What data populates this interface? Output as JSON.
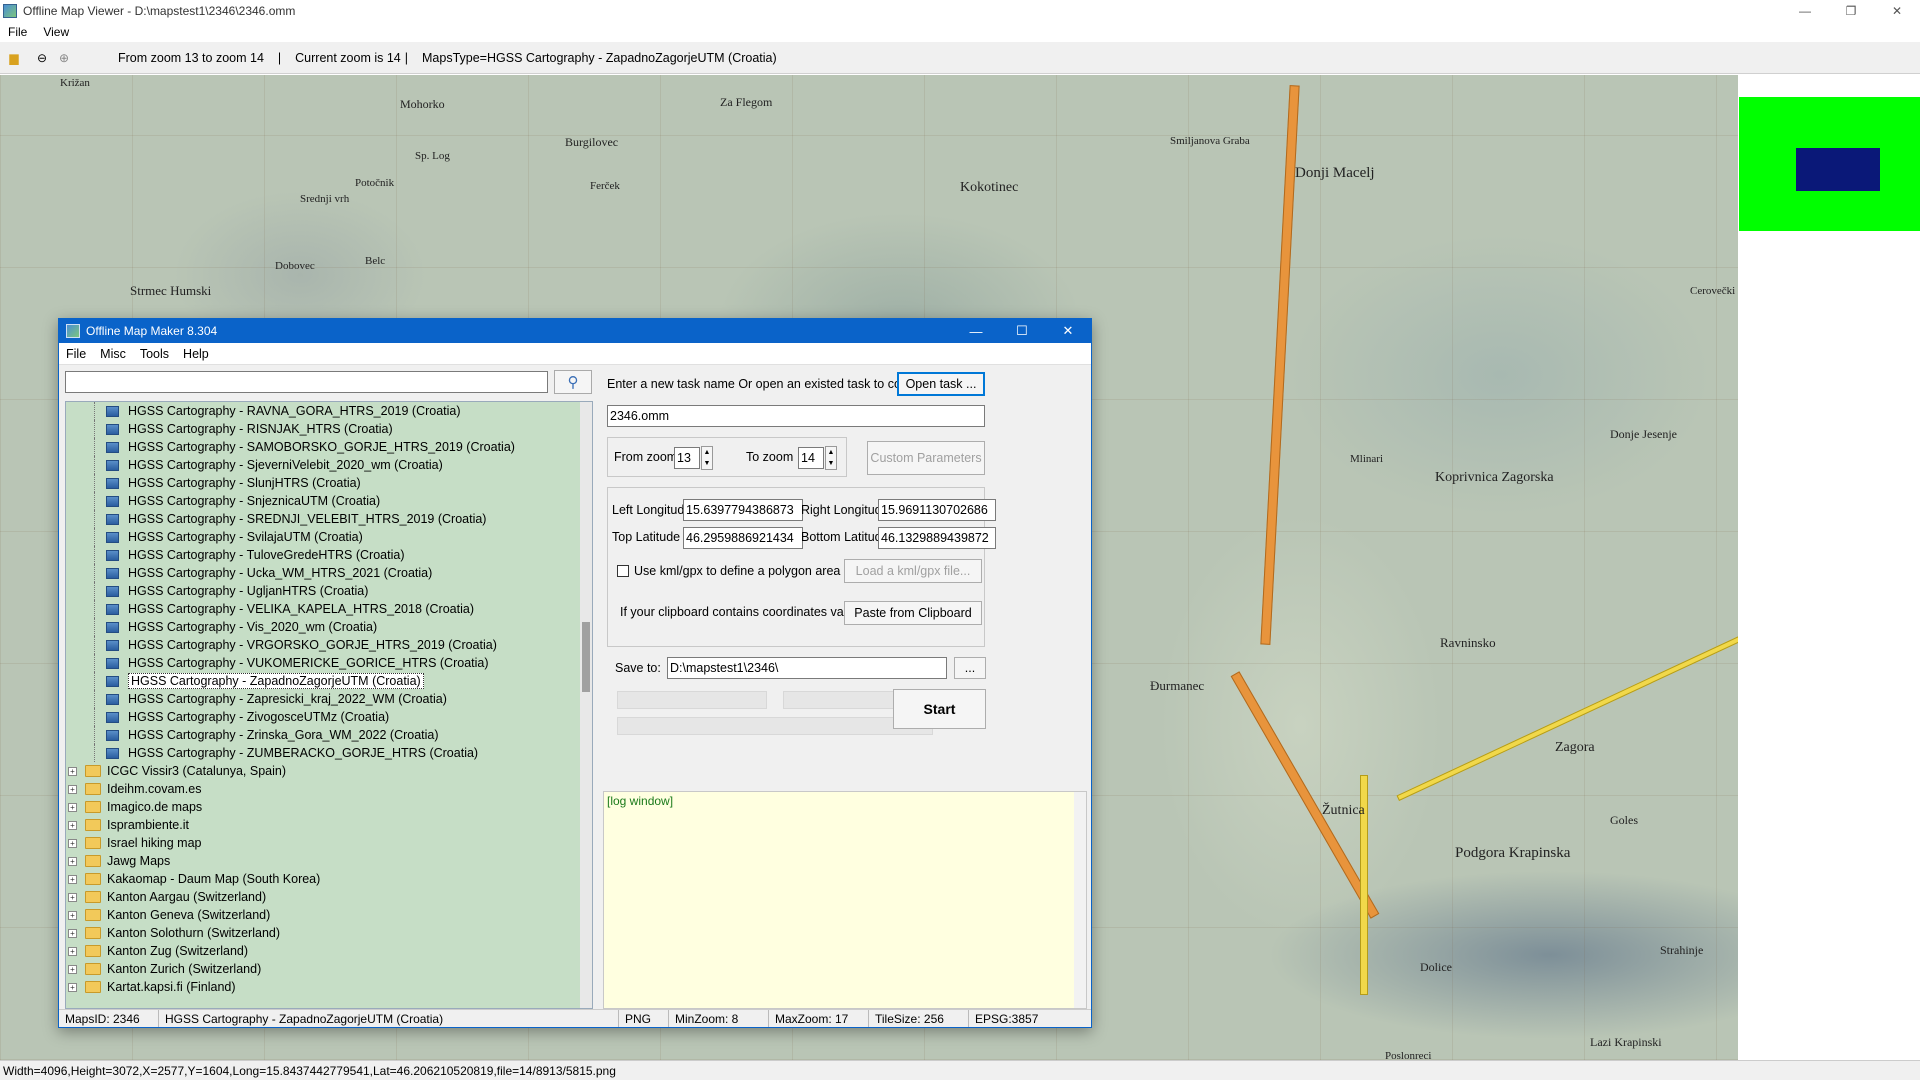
{
  "main_window": {
    "title": "Offline Map Viewer - D:\\mapstest1\\2346\\2346.omm",
    "menu": [
      "File",
      "View"
    ],
    "win_buttons": {
      "minimize": "—",
      "restore": "❐",
      "close": "✕"
    }
  },
  "toolbar": {
    "zoom_range": "From zoom 13 to zoom 14",
    "sep1": "|",
    "current_zoom": "Current zoom is 14",
    "sep2": "|",
    "maps_type": "MapsType=HGSS Cartography - ZapadnoZagorjeUTM (Croatia)"
  },
  "map_labels": [
    {
      "text": "Križan"
    },
    {
      "text": "Mohorko"
    },
    {
      "text": "Za Flegom"
    },
    {
      "text": "Burgilovec"
    },
    {
      "text": "Sp. Log"
    },
    {
      "text": "Potočnik"
    },
    {
      "text": "Ferček"
    },
    {
      "text": "Srednji vrh"
    },
    {
      "text": "Kokotinec"
    },
    {
      "text": "Smiljanova Graba"
    },
    {
      "text": "Donji Macelj"
    },
    {
      "text": "Strmec Humski"
    },
    {
      "text": "Dobovec"
    },
    {
      "text": "Belc"
    },
    {
      "text": "Koprivnica Zagorska"
    },
    {
      "text": "Donje Jesenje"
    },
    {
      "text": "Mlinari"
    },
    {
      "text": "Ravninsko"
    },
    {
      "text": "Đurmanec"
    },
    {
      "text": "Žutnica"
    },
    {
      "text": "Zagora"
    },
    {
      "text": "Podgora Krapinska"
    },
    {
      "text": "Strahinje"
    },
    {
      "text": "Dolice"
    },
    {
      "text": "Lazi Krapinski"
    },
    {
      "text": "Goles"
    },
    {
      "text": "Cerovečki"
    },
    {
      "text": "Poslonreci"
    }
  ],
  "status_text": "Width=4096,Height=3072,X=2577,Y=1604,Long=15.8437442779541,Lat=46.206210520819,file=14/8913/5815.png",
  "colors": {
    "overview_green": "#00ff00",
    "overview_blue": "#0a1878",
    "dialog_accent": "#0a63c9",
    "tree_bg": "#c6dec6",
    "log_bg": "#ffffe0"
  },
  "dialog": {
    "title": "Offline Map Maker 8.304",
    "menu": [
      "File",
      "Misc",
      "Tools",
      "Help"
    ],
    "search": {
      "value": "",
      "icon": "search-icon"
    },
    "tree_children": [
      "HGSS Cartography - RAVNA_GORA_HTRS_2019 (Croatia)",
      "HGSS Cartography - RISNJAK_HTRS (Croatia)",
      "HGSS Cartography - SAMOBORSKO_GORJE_HTRS_2019 (Croatia)",
      "HGSS Cartography - SjeverniVelebit_2020_wm (Croatia)",
      "HGSS Cartography - SlunjHTRS (Croatia)",
      "HGSS Cartography - SnjeznicaUTM (Croatia)",
      "HGSS Cartography - SREDNJI_VELEBIT_HTRS_2019 (Croatia)",
      "HGSS Cartography - SvilajaUTM (Croatia)",
      "HGSS Cartography - TuloveGredeHTRS (Croatia)",
      "HGSS Cartography - Ucka_WM_HTRS_2021 (Croatia)",
      "HGSS Cartography - UgljanHTRS (Croatia)",
      "HGSS Cartography - VELIKA_KAPELA_HTRS_2018 (Croatia)",
      "HGSS Cartography - Vis_2020_wm (Croatia)",
      "HGSS Cartography - VRGORSKO_GORJE_HTRS_2019 (Croatia)",
      "HGSS Cartography - VUKOMERICKE_GORICE_HTRS (Croatia)",
      "HGSS Cartography - ZapadnoZagorjeUTM (Croatia)",
      "HGSS Cartography - Zapresicki_kraj_2022_WM (Croatia)",
      "HGSS Cartography - ZivogosceUTMz (Croatia)",
      "HGSS Cartography - Zrinska_Gora_WM_2022 (Croatia)",
      "HGSS Cartography - ZUMBERACKO_GORJE_HTRS (Croatia)"
    ],
    "selected_index": 15,
    "tree_folders": [
      "ICGC Vissir3 (Catalunya, Spain)",
      "Ideihm.covam.es",
      "Imagico.de maps",
      "Isprambiente.it",
      "Israel hiking map",
      "Jawg Maps",
      "Kakaomap - Daum Map (South Korea)",
      "Kanton Aargau (Switzerland)",
      "Kanton Geneva (Switzerland)",
      "Kanton Solothurn (Switzerland)",
      "Kanton Zug (Switzerland)",
      "Kanton Zurich (Switzerland)",
      "Kartat.kapsi.fi (Finland)"
    ],
    "task_prompt": "Enter a new task name Or open an existed task to continue:",
    "open_task_label": "Open task ...",
    "task_name": "2346.omm",
    "from_zoom_label": "From zoom",
    "from_zoom": "13",
    "to_zoom_label": "To zoom",
    "to_zoom": "14",
    "custom_params_label": "Custom Parameters",
    "left_lon_label": "Left Longitude",
    "left_lon": "15.6397794386873",
    "right_lon_label": "Right Longitude",
    "right_lon": "15.9691130702686",
    "top_lat_label": "Top Latitude",
    "top_lat": "46.2959886921434",
    "bottom_lat_label": "Bottom Latitude",
    "bottom_lat": "46.1329889439872",
    "kml_label": "Use kml/gpx to define a polygon area",
    "load_kml_label": "Load a kml/gpx file...",
    "clipboard_prompt": "If your clipboard contains coordinates values:",
    "paste_label": "Paste from Clipboard",
    "save_to_label": "Save to:",
    "save_to": "D:\\mapstest1\\2346\\",
    "browse_label": "...",
    "start_label": "Start",
    "log_text": "[log window]",
    "status": {
      "maps_id": "MapsID: 2346",
      "map_name": "HGSS Cartography - ZapadnoZagorjeUTM (Croatia)",
      "format": "PNG",
      "min_zoom": "MinZoom: 8",
      "max_zoom": "MaxZoom: 17",
      "tile_size": "TileSize: 256",
      "epsg": "EPSG:3857"
    }
  }
}
